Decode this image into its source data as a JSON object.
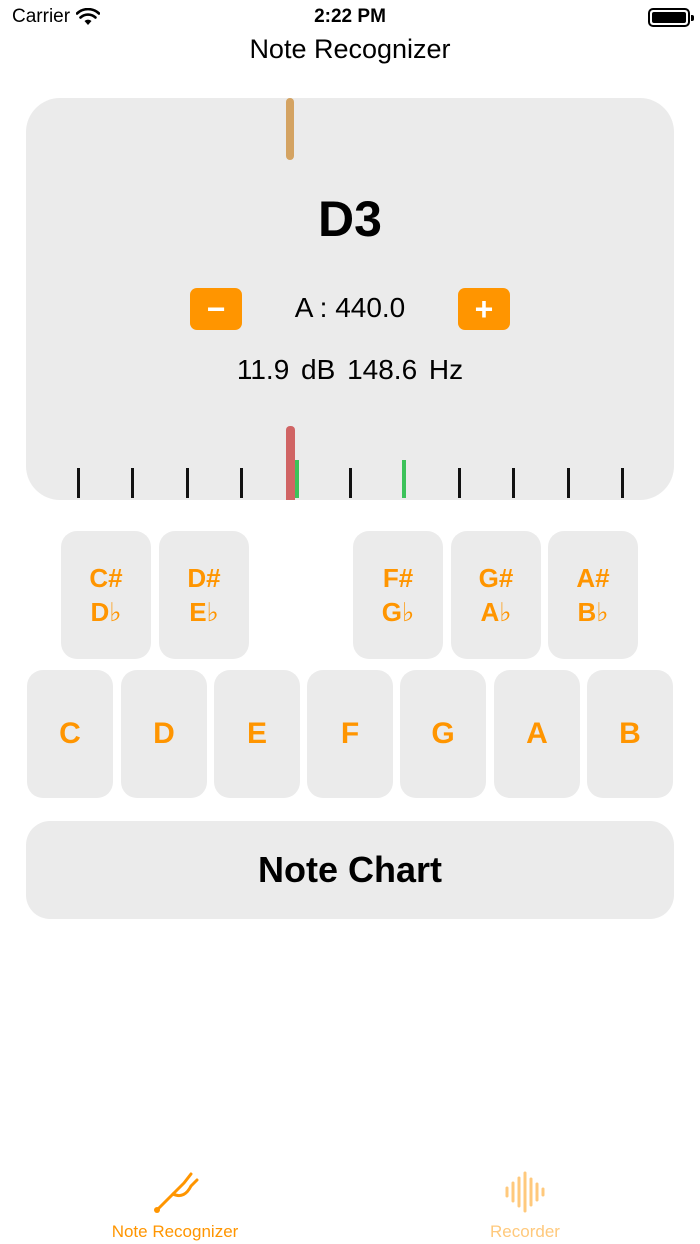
{
  "status_bar": {
    "carrier": "Carrier",
    "time": "2:22 PM"
  },
  "nav": {
    "title": "Note Recognizer"
  },
  "tuner": {
    "note": "D3",
    "minus_label": "−",
    "plus_label": "+",
    "reference": "A : 440.0",
    "reading": "11.9 dB  148.6 Hz"
  },
  "black_keys": [
    {
      "top": "C#",
      "bottom": "D♭"
    },
    {
      "top": "D#",
      "bottom": "E♭"
    },
    {
      "top": "F#",
      "bottom": "G♭"
    },
    {
      "top": "G#",
      "bottom": "A♭"
    },
    {
      "top": "A#",
      "bottom": "B♭"
    }
  ],
  "white_keys": [
    "C",
    "D",
    "E",
    "F",
    "G",
    "A",
    "B"
  ],
  "note_chart_label": "Note Chart",
  "tabs": [
    {
      "label": "Note Recognizer",
      "icon": "tuning-fork-icon",
      "active": true
    },
    {
      "label": "Recorder",
      "icon": "waveform-icon",
      "active": false
    }
  ],
  "colors": {
    "accent": "#ff9500",
    "accent_inactive": "#ffc97c",
    "card_bg": "#ebebeb",
    "needle": "#d06464",
    "top_indicator": "#d4a362",
    "in_tune_marker": "#3cc25a"
  }
}
